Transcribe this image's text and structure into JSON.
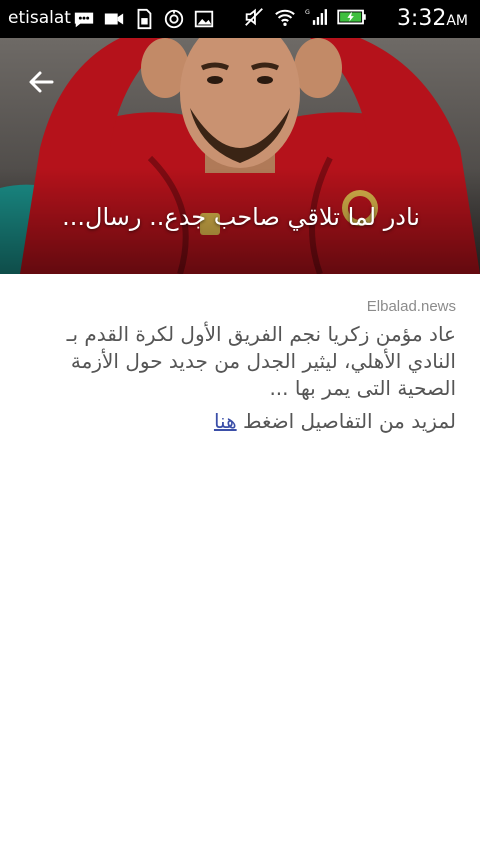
{
  "status_bar": {
    "carrier": "etisalat",
    "time": "3:32",
    "ampm": "AM",
    "left_icons": [
      "chat-icon",
      "video-icon",
      "sim-icon",
      "alarm-icon",
      "image-icon"
    ],
    "right_icons": [
      "mute-icon",
      "wifi-icon",
      "signal-icon",
      "battery-charging-icon"
    ],
    "network_type": "G"
  },
  "header": {
    "title": "نادر لما تلاقي صاحب جدع.. رسال...",
    "back_icon": "back-arrow-icon"
  },
  "article": {
    "source": "Elbalad.news",
    "summary": "عاد مؤمن زكريا نجم الفريق الأول لكرة القدم بـ النادي الأهلي، ليثير الجدل من جديد حول الأزمة الصحية التى يمر بها ...",
    "more_prefix": "لمزيد من التفاصيل اضغط ",
    "more_link": "هنا"
  },
  "colors": {
    "link": "#3b4fa8",
    "jersey_red": "#b5121b",
    "accent_teal": "#1a8c86"
  }
}
